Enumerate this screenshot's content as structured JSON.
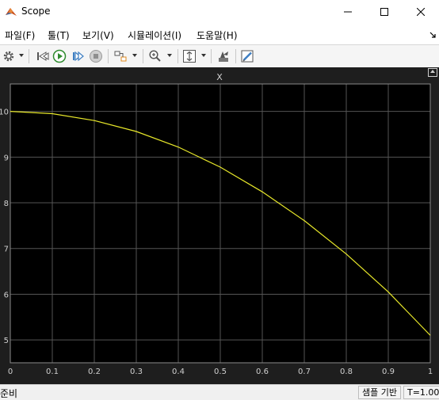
{
  "window": {
    "title": "Scope"
  },
  "menu": [
    "파일(F)",
    "툴(T)",
    "보기(V)",
    "시뮬레이션(I)",
    "도움말(H)"
  ],
  "toolbar": {
    "items": [
      "settings-icon",
      "step-back-icon",
      "run-icon",
      "step-forward-icon",
      "stop-icon",
      "highlight-icon",
      "zoom-icon",
      "scale-icon",
      "restore-icon",
      "properties-icon"
    ]
  },
  "plot": {
    "title": "X"
  },
  "chart_data": {
    "type": "line",
    "title": "X",
    "xlabel": "",
    "ylabel": "",
    "xlim": [
      0,
      1
    ],
    "ylim": [
      4.5,
      10.6
    ],
    "xticks": [
      "0",
      "0.1",
      "0.2",
      "0.3",
      "0.4",
      "0.5",
      "0.6",
      "0.7",
      "0.8",
      "0.9",
      "1"
    ],
    "yticks": [
      "10",
      "9",
      "8",
      "7",
      "6",
      "5"
    ],
    "grid": true,
    "series": [
      {
        "color": "#e8e82a",
        "x": [
          0,
          0.1,
          0.2,
          0.3,
          0.4,
          0.5,
          0.6,
          0.7,
          0.8,
          0.9,
          1.0
        ],
        "y": [
          10.0,
          9.95,
          9.8,
          9.56,
          9.22,
          8.78,
          8.24,
          7.61,
          6.88,
          6.05,
          5.1
        ]
      }
    ],
    "background": "#000000",
    "grid_color": "#555555"
  },
  "status": {
    "left": "준비",
    "mode": "샘플 기반",
    "time": "T=1.000"
  }
}
